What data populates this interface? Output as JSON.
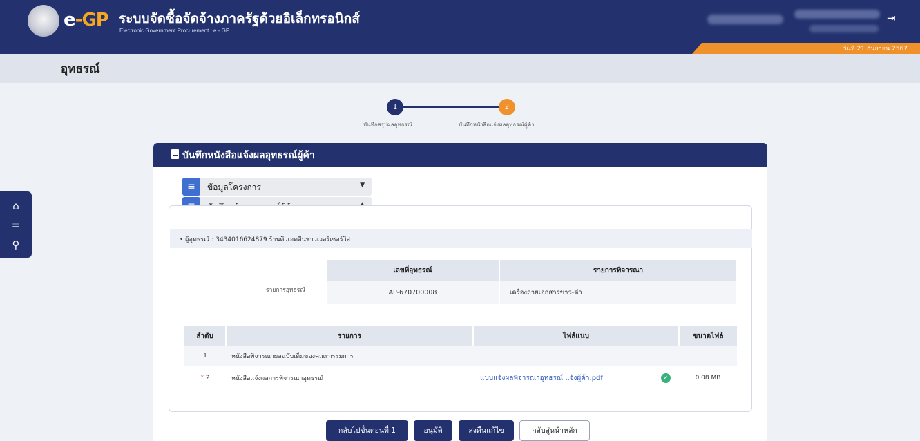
{
  "header": {
    "logo_e": "e",
    "logo_dash": "-",
    "logo_gp": "GP",
    "title": "ระบบจัดซื้อจัดจ้างภาครัฐด้วยอิเล็กทรอนิกส์",
    "subtitle": "Electronic Government Procurement : e - GP",
    "logout_icon": "logout-icon",
    "date": "วันที่ 21 กันยายน 2567"
  },
  "page": {
    "title": "อุทธรณ์"
  },
  "side_menu": {
    "icons": [
      "home-icon",
      "menu-icon",
      "search-icon"
    ]
  },
  "stepper": {
    "steps": [
      {
        "number": "1",
        "label": "บันทึกสรุปผลอุทธรณ์"
      },
      {
        "number": "2",
        "label": "บันทึกหนังสือแจ้งผลอุทธรณ์ผู้ค้า"
      }
    ]
  },
  "panel": {
    "title": "บันทึกหนังสือแจ้งผลอุทธรณ์ผู้ค้า",
    "accordions": [
      {
        "label": "ข้อมูลโครงการ",
        "caret": "▼"
      },
      {
        "label": "บันทึกแจ้งผลอุทธรณ์ผู้ค้า",
        "caret": "▲"
      }
    ],
    "vendor": "• ผู้อุทธรณ์ : 3434016624879 ร้านคิวเอคลีนพาวเวอร์เซอร์วิส",
    "appeal_label": "รายการอุทธรณ์",
    "appeal_table": {
      "headers": [
        "เลขที่อุทธรณ์",
        "รายการพิจารณา"
      ],
      "rows": [
        [
          "AP-670700008",
          "เครื่องถ่ายเอกสารขาว-ดำ"
        ]
      ]
    },
    "files_table": {
      "headers": [
        "ลำดับ",
        "รายการ",
        "ไฟล์แนบ",
        "ขนาดไฟล์"
      ],
      "rows": [
        {
          "no": "1",
          "required": "",
          "item": "หนังสือพิจารณาผลฉบับเต็มของคณะกรรมการ",
          "file": "",
          "size": ""
        },
        {
          "no": "2",
          "required": "*",
          "item": "หนังสือแจ้งผลการพิจารณาอุทธรณ์",
          "file": "แบบแจ้งผลพิจารณาอุทธรณ์ แจ้งผู้ค้า.pdf",
          "size": "0.08 MB"
        }
      ]
    }
  },
  "buttons": {
    "back": "กลับไปขั้นตอนที่ 1",
    "approve": "อนุมัติ",
    "return": "ส่งคืนแก้ไข",
    "home": "กลับสู่หน้าหลัก"
  },
  "colors": {
    "navy": "#23326e",
    "orange": "#f0922b",
    "blue": "#3f6fd1",
    "green": "#3ab07a"
  }
}
